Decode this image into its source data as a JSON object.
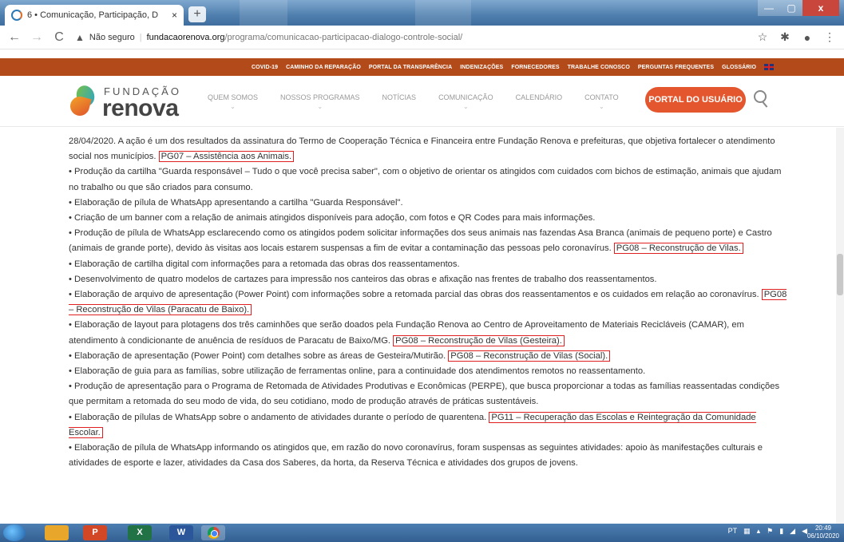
{
  "browser": {
    "tab_title": "6 • Comunicação, Participação, D",
    "tab_close": "×",
    "new_tab": "+",
    "back": "←",
    "forward": "→",
    "reload": "C",
    "security_label": "Não seguro",
    "url_host": "fundacaorenova.org",
    "url_path": "/programa/comunicacao-participacao-dialogo-controle-social/",
    "window_controls": {
      "minimize": "—",
      "maximize": "▢",
      "close": "x"
    }
  },
  "top_strip": {
    "links": [
      "COVID-19",
      "CAMINHO DA REPARAÇÃO",
      "PORTAL DA TRANSPARÊNCIA",
      "INDENIZAÇÕES",
      "FORNECEDORES",
      "TRABALHE CONOSCO",
      "PERGUNTAS FREQUENTES",
      "GLOSSÁRIO"
    ]
  },
  "header": {
    "logo_top": "FUNDAÇÃO",
    "logo_main": "renova",
    "nav": [
      {
        "label": "QUEM SOMOS"
      },
      {
        "label": "NOSSOS PROGRAMAS"
      },
      {
        "label": "NOTÍCIAS"
      },
      {
        "label": "COMUNICAÇÃO"
      },
      {
        "label": "CALENDÁRIO"
      },
      {
        "label": "CONTATO"
      }
    ],
    "portal_button": "PORTAL DO USUÁRIO"
  },
  "content": {
    "p1_text": "28/04/2020. A ação é um dos resultados da assinatura do Termo de Cooperação Técnica e Financeira entre Fundação Renova e prefeituras, que objetiva fortalecer o atendimento social nos municípios.",
    "p1_tag": "PG07 – Assistência aos Animais.",
    "p2": "• Produção da cartilha \"Guarda responsável – Tudo o que você precisa saber\", com o objetivo de orientar os atingidos com cuidados com bichos de estimação, animais que ajudam no trabalho ou que são criados para consumo.",
    "p3": "• Elaboração de pílula de WhatsApp apresentando a cartilha \"Guarda Responsável\".",
    "p4": "• Criação de um banner com a relação de animais atingidos disponíveis para adoção, com fotos e QR Codes para mais informações.",
    "p5_text": "• Produção de pílula de WhatsApp esclarecendo como os atingidos podem solicitar informações dos seus animais nas fazendas Asa Branca (animais de pequeno porte) e Castro (animais de grande porte), devido às visitas aos locais estarem suspensas a fim de evitar a contaminação das pessoas pelo coronavírus.",
    "p5_tag": "PG08 – Reconstrução de Vilas.",
    "p6": "• Elaboração de cartilha digital com informações para a retomada das obras dos reassentamentos.",
    "p7": "• Desenvolvimento de quatro modelos de cartazes para impressão nos canteiros das obras e afixação nas frentes de trabalho dos reassentamentos.",
    "p8_text": "• Elaboração de arquivo de apresentação (Power Point) com informações sobre a retomada parcial das obras dos reassentamentos e os cuidados em relação ao coronavírus.",
    "p8_tag": "PG08 – Reconstrução de Vilas (Paracatu de Baixo).",
    "p9_text": "• Elaboração de layout para plotagens dos três caminhões que serão doados pela Fundação Renova ao Centro de Aproveitamento de Materiais Recicláveis (CAMAR), em atendimento à condicionante de anuência de resíduos de Paracatu de Baixo/MG.",
    "p9_tag": "PG08 – Reconstrução de Vilas (Gesteira).",
    "p10_text": "• Elaboração de apresentação (Power Point) com detalhes sobre as áreas de Gesteira/Mutirão.",
    "p10_tag": "PG08 – Reconstrução de Vilas (Social).",
    "p11": "• Elaboração de guia para as famílias, sobre utilização de ferramentas online, para a continuidade dos atendimentos remotos no reassentamento.",
    "p12": "• Produção de apresentação para o Programa de Retomada de Atividades Produtivas e Econômicas (PERPE), que busca proporcionar a todas as famílias reassentadas condições que permitam a retomada do seu modo de vida, do seu cotidiano, modo de produção através de práticas sustentáveis.",
    "p13_text": "• Elaboração de pílulas de WhatsApp sobre o andamento de atividades durante o período de quarentena.",
    "p13_tag": "PG11 – Recuperação das Escolas e Reintegração da Comunidade Escolar.",
    "p14": "• Elaboração de pílula de WhatsApp informando os atingidos que, em razão do novo coronavírus, foram suspensas as seguintes atividades: apoio às manifestações culturais e atividades de esporte e lazer, atividades da Casa dos Saberes, da horta, da Reserva Técnica e atividades dos grupos de jovens."
  },
  "taskbar": {
    "ppt": "P",
    "excel": "X",
    "word": "W",
    "tray_lang": "PT",
    "clock_time": "20:49",
    "clock_date": "06/10/2020"
  },
  "colors": {
    "highlight_border": "#e02020",
    "top_strip": "#b34a1a",
    "portal_button": "#e4572e"
  }
}
